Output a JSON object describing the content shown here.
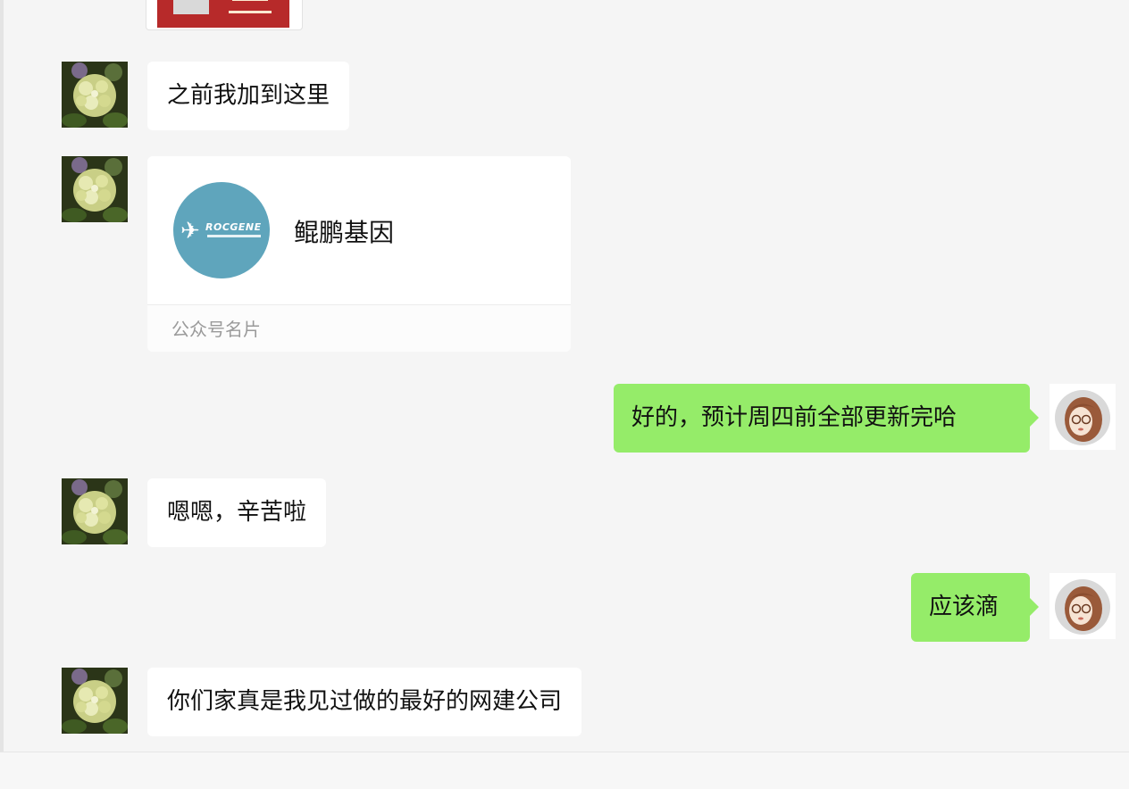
{
  "chat": {
    "messages": [
      {
        "side": "in",
        "text": "之前我加到这里"
      },
      {
        "side": "in",
        "type": "official_account_card",
        "name": "鲲鹏基因",
        "logo_text": "ROCGENE",
        "label": "公众号名片"
      },
      {
        "side": "out",
        "text": "好的，预计周四前全部更新完哈"
      },
      {
        "side": "in",
        "text": "嗯嗯，辛苦啦"
      },
      {
        "side": "out",
        "text": "应该滴"
      },
      {
        "side": "in",
        "text": "你们家真是我见过做的最好的网建公司"
      }
    ]
  },
  "colors": {
    "background": "#f5f5f5",
    "outgoing_bubble": "#95ec69",
    "incoming_bubble": "#ffffff",
    "card_logo": "#5fa5bc"
  },
  "icons": {
    "contact_avatar": "hydrangea-flower-avatar",
    "self_avatar": "cartoon-girl-avatar"
  }
}
